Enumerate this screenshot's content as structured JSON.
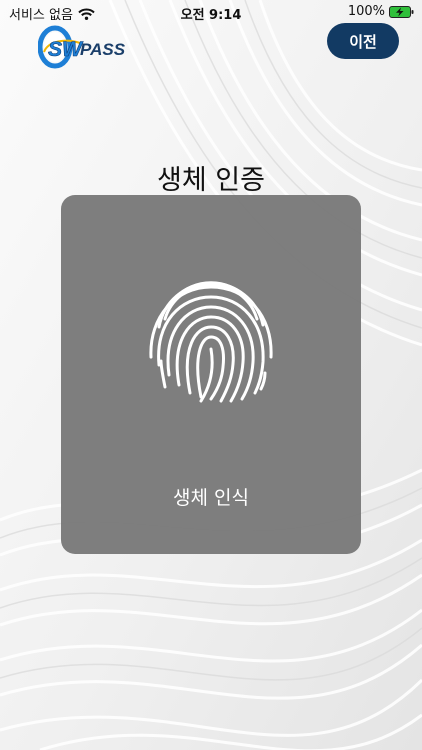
{
  "status_bar": {
    "carrier": "서비스 없음",
    "time": "오전 9:14",
    "battery": "100%"
  },
  "header": {
    "logo_text": "SWPASS",
    "back_label": "이전"
  },
  "title": "생체 인증",
  "card": {
    "label": "생체 인식"
  },
  "colors": {
    "back_button": "#123a63",
    "card": "#7a7a7a",
    "battery": "#2fbf3a",
    "logo_blue": "#1e7fd6"
  }
}
